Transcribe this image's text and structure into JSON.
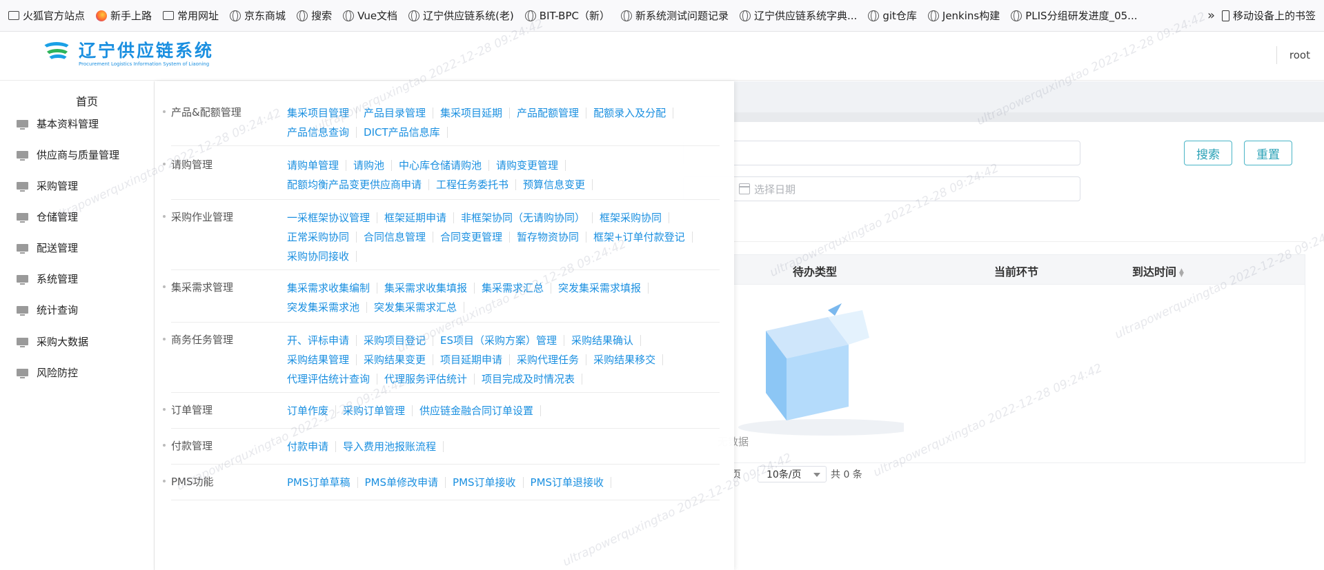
{
  "bookmarks": {
    "items": [
      {
        "label": "火狐官方站点",
        "icon": "folder-icon"
      },
      {
        "label": "新手上路",
        "icon": "firefox-icon"
      },
      {
        "label": "常用网址",
        "icon": "folder-icon"
      },
      {
        "label": "京东商城",
        "icon": "globe-icon"
      },
      {
        "label": "搜索",
        "icon": "globe-icon"
      },
      {
        "label": "Vue文档",
        "icon": "globe-icon"
      },
      {
        "label": "辽宁供应链系统(老)",
        "icon": "globe-icon"
      },
      {
        "label": "BIT-BPC（新）",
        "icon": "globe-icon"
      },
      {
        "label": "新系统测试问题记录",
        "icon": "globe-icon"
      },
      {
        "label": "辽宁供应链系统字典...",
        "icon": "globe-icon"
      },
      {
        "label": "git仓库",
        "icon": "globe-icon"
      },
      {
        "label": "Jenkins构建",
        "icon": "globe-icon"
      },
      {
        "label": "PLIS分组研发进度_05...",
        "icon": "globe-icon"
      }
    ],
    "more": "»",
    "mobile": "移动设备上的书签"
  },
  "header": {
    "title": "辽宁供应链系统",
    "subtitle": "Procurement Logistics Information System of Liaoning",
    "user": "root"
  },
  "sidebar": {
    "home": "首页",
    "items": [
      {
        "label": "基本资料管理"
      },
      {
        "label": "供应商与质量管理"
      },
      {
        "label": "采购管理"
      },
      {
        "label": "仓储管理"
      },
      {
        "label": "配送管理"
      },
      {
        "label": "系统管理"
      },
      {
        "label": "统计查询"
      },
      {
        "label": "采购大数据"
      },
      {
        "label": "风险防控"
      }
    ]
  },
  "menu": {
    "groups": [
      {
        "title": "产品&配额管理",
        "links": [
          "集采项目管理",
          "产品目录管理",
          "集采项目延期",
          "产品配额管理",
          "配额录入及分配",
          "产品信息查询",
          "DICT产品信息库"
        ]
      },
      {
        "title": "请购管理",
        "links": [
          "请购单管理",
          "请购池",
          "中心库仓储请购池",
          "请购变更管理",
          "配额均衡产品变更供应商申请",
          "工程任务委托书",
          "预算信息变更"
        ]
      },
      {
        "title": "采购作业管理",
        "links": [
          "一采框架协议管理",
          "框架延期申请",
          "非框架协同（无请购协同）",
          "框架采购协同",
          "正常采购协同",
          "合同信息管理",
          "合同变更管理",
          "暂存物资协同",
          "框架+订单付款登记",
          "采购协同接收"
        ]
      },
      {
        "title": "集采需求管理",
        "links": [
          "集采需求收集编制",
          "集采需求收集填报",
          "集采需求汇总",
          "突发集采需求填报",
          "突发集采需求池",
          "突发集采需求汇总"
        ]
      },
      {
        "title": "商务任务管理",
        "links": [
          "开、评标申请",
          "采购项目登记",
          "ES项目（采购方案）管理",
          "采购结果确认",
          "采购结果管理",
          "采购结果变更",
          "项目延期申请",
          "采购代理任务",
          "采购结果移交",
          "代理评估统计查询",
          "代理服务评估统计",
          "项目完成及时情况表"
        ]
      },
      {
        "title": "订单管理",
        "links": [
          "订单作废",
          "采购订单管理",
          "供应链金融合同订单设置"
        ]
      },
      {
        "title": "付款管理",
        "links": [
          "付款申请",
          "导入费用池报账流程"
        ]
      },
      {
        "title": "PMS功能",
        "links": [
          "PMS订单草稿",
          "PMS单修改申请",
          "PMS订单接收",
          "PMS订单退接收"
        ]
      }
    ]
  },
  "search": {
    "search_label": "搜索",
    "reset_label": "重置",
    "date_placeholder": "选择日期"
  },
  "table": {
    "columns": [
      "待办类型",
      "当前环节",
      "到达时间"
    ],
    "empty_text": "无数据"
  },
  "pager": {
    "prefix": "页",
    "page_size": "10条/页",
    "total": "共 0 条"
  },
  "watermark": "ultrapowerquxingtao 2022-12-28 09:24:42",
  "colors": {
    "accent": "#1a8fe0",
    "button": "#2aa1b6"
  }
}
